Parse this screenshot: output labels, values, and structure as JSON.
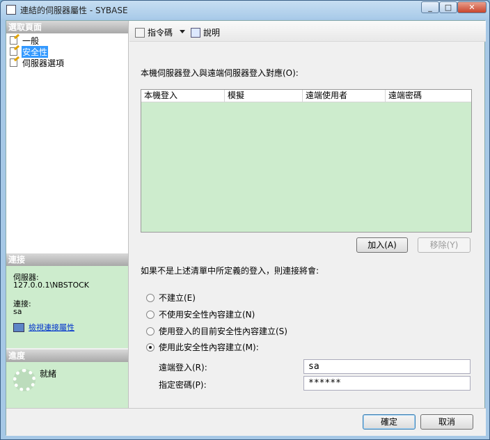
{
  "window": {
    "title": "連結的伺服器屬性 - SYBASE"
  },
  "left": {
    "select_page_header": "選取頁面",
    "pages": [
      {
        "label": "一般",
        "selected": false
      },
      {
        "label": "安全性",
        "selected": true
      },
      {
        "label": "伺服器選項",
        "selected": false
      }
    ],
    "connection_header": "連接",
    "server_label": "伺服器:",
    "server_value": "127.0.0.1\\NBSTOCK",
    "connection_label": "連接:",
    "connection_value": "sa",
    "view_connection_props": "檢視連接屬性",
    "progress_header": "進度",
    "progress_status": "就緒"
  },
  "toolbar": {
    "script_label": "指令碼",
    "help_label": "說明"
  },
  "main": {
    "mapping_label": "本機伺服器登入與遠端伺服器登入對應(O):",
    "columns": [
      "本機登入",
      "模擬",
      "遠端使用者",
      "遠端密碼"
    ],
    "add_button": "加入(A)",
    "remove_button": "移除(Y)",
    "not_defined_label": "如果不是上述清單中所定義的登入，則連接將會:",
    "radio_options": [
      {
        "label": "不建立(E)",
        "checked": false
      },
      {
        "label": "不使用安全性內容建立(N)",
        "checked": false
      },
      {
        "label": "使用登入的目前安全性內容建立(S)",
        "checked": false
      },
      {
        "label": "使用此安全性內容建立(M):",
        "checked": true
      }
    ],
    "remote_login_label": "遠端登入(R):",
    "remote_login_value": "sa",
    "password_label": "指定密碼(P):",
    "password_value": "******"
  },
  "footer": {
    "ok_label": "確定",
    "cancel_label": "取消"
  }
}
